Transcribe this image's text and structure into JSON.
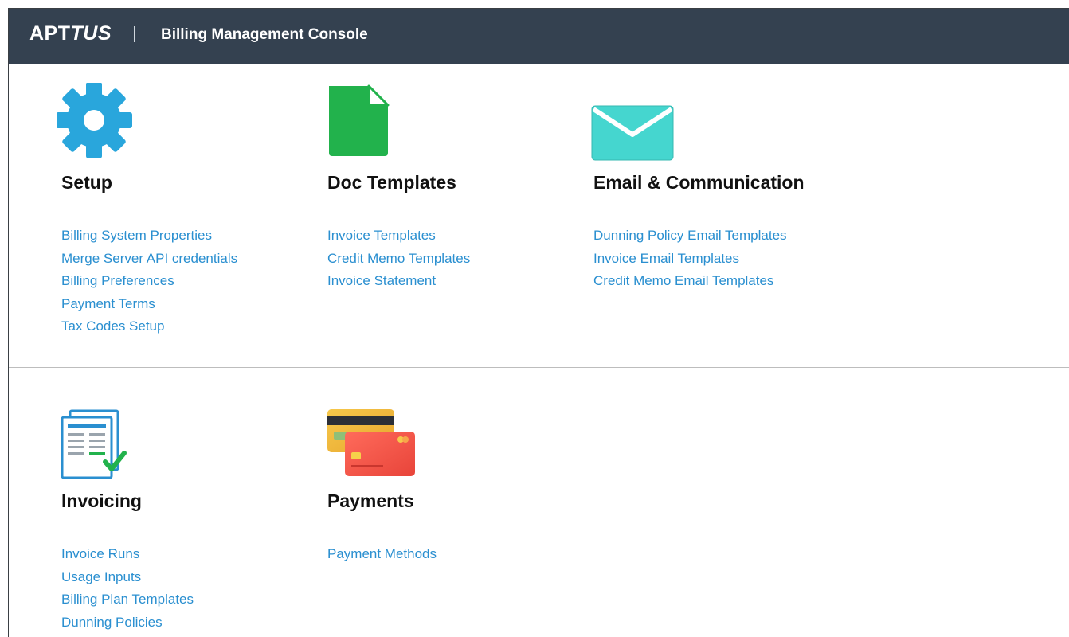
{
  "header": {
    "brand_main": "APT",
    "brand_italic": "TUS",
    "title": "Billing Management Console"
  },
  "colors": {
    "header_bg": "#344150",
    "link": "#2a8fd0",
    "gear": "#29a6dc",
    "doc": "#22b24c",
    "envelope": "#45d6cf"
  },
  "cards": {
    "setup": {
      "icon": "gear-icon",
      "title": "Setup",
      "links": [
        "Billing System Properties",
        "Merge Server API credentials",
        "Billing Preferences",
        "Payment Terms",
        "Tax Codes Setup"
      ]
    },
    "doc": {
      "icon": "document-icon",
      "title": "Doc Templates",
      "links": [
        "Invoice Templates",
        "Credit Memo Templates",
        "Invoice Statement"
      ]
    },
    "email": {
      "icon": "envelope-icon",
      "title": "Email & Communication",
      "links": [
        "Dunning Policy Email Templates",
        "Invoice Email Templates",
        "Credit Memo Email Templates"
      ]
    },
    "invoicing": {
      "icon": "invoice-check-icon",
      "title": "Invoicing",
      "links": [
        "Invoice Runs",
        "Usage Inputs",
        "Billing Plan Templates",
        "Dunning Policies"
      ]
    },
    "payments": {
      "icon": "credit-cards-icon",
      "title": "Payments",
      "links": [
        "Payment Methods"
      ]
    }
  }
}
